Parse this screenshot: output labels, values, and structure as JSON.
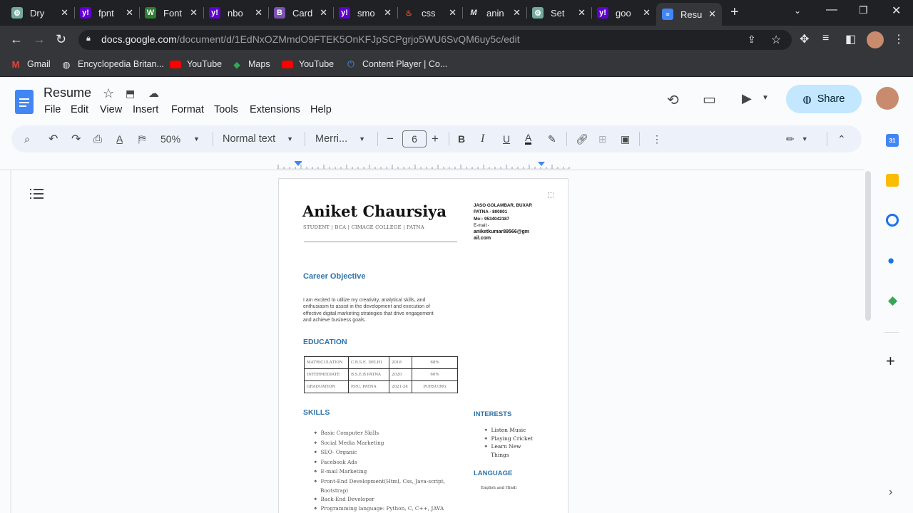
{
  "browser": {
    "tabs": [
      {
        "label": "Dry",
        "favicon": "chatgpt-icon",
        "color": "#74aa9c"
      },
      {
        "label": "fpnt",
        "favicon": "yahoo-icon",
        "color": "#6001d2"
      },
      {
        "label": "Font",
        "favicon": "w-icon",
        "color": "#1b5e20"
      },
      {
        "label": "nbo",
        "favicon": "yahoo-icon",
        "color": "#6001d2"
      },
      {
        "label": "Card",
        "favicon": "b-icon",
        "color": "#7952b3"
      },
      {
        "label": "smo",
        "favicon": "yahoo-icon",
        "color": "#6001d2"
      },
      {
        "label": "css",
        "favicon": "css-icon",
        "color": "#e44d26"
      },
      {
        "label": "anin",
        "favicon": "m-icon",
        "color": "#202124"
      },
      {
        "label": "Set",
        "favicon": "chatgpt-icon",
        "color": "#74aa9c"
      },
      {
        "label": "goo",
        "favicon": "yahoo-icon",
        "color": "#6001d2"
      },
      {
        "label": "Resu",
        "favicon": "docs-icon",
        "color": "#4285f4"
      }
    ],
    "url_host": "docs.google.com",
    "url_path": "/document/d/1EdNxOZMmdO9FTEK5OnKFJpSCPgrjo5WU6SvQM6uy5c/edit",
    "bookmarks": [
      {
        "label": "Gmail",
        "icon": "gmail-icon"
      },
      {
        "label": "Encyclopedia Britan...",
        "icon": "globe-icon"
      },
      {
        "label": "YouTube",
        "icon": "youtube-icon"
      },
      {
        "label": "Maps",
        "icon": "maps-icon"
      },
      {
        "label": "YouTube",
        "icon": "youtube-icon"
      },
      {
        "label": "Content Player | Co...",
        "icon": "power-icon"
      }
    ]
  },
  "docs": {
    "title": "Resume",
    "menu": [
      "File",
      "Edit",
      "View",
      "Insert",
      "Format",
      "Tools",
      "Extensions",
      "Help"
    ],
    "share_label": "Share",
    "toolbar": {
      "zoom": "50%",
      "style": "Normal text",
      "font": "Merri...",
      "font_size": "6",
      "minus": "−",
      "plus": "+"
    }
  },
  "resume": {
    "name": "Aniket Chaursiya",
    "subtitle": "STUDENT | BCA | CIMAGE COLLEGE | PATNA",
    "contact": [
      "JASO GOLAMBAR, BUXAR",
      "PATNA - 800001",
      "Mo:- 9534042187",
      "E-mail:-",
      "aniketkumar89566@gm",
      "ail.com"
    ],
    "career_objective_title": "Career Objective",
    "career_objective_lines": [
      "I am excited to utilize my creativity, analytical skills, and",
      "enthusiasm to assist in the development and execution of",
      "effective digital marketing strategies that drive engagement",
      "and achieve business goals."
    ],
    "education_title": "EDUCATION",
    "education": [
      [
        "MATRICULATION",
        "C.B.S.E. DELHI",
        "2018",
        "68%"
      ],
      [
        "INTERMEDIATE",
        "B.S.E.B PATNA",
        "2020",
        "60%"
      ],
      [
        "GRADUATION",
        "P.P.U. PATNA",
        "2021-24",
        "PURSUING"
      ]
    ],
    "skills_title": "SKILLS",
    "skills": [
      "Basic Computer Skills",
      "Social Media Marketing",
      "SEO- Organic",
      "Facebook Ads",
      "E-mail Marketing",
      "Front-End Development(Html, Css, Java-script, Bootstrap)",
      "Back-End Developer",
      "Programming language: Python, C, C++, JAVA"
    ],
    "interests_title": "INTERESTS",
    "interests": [
      "Listen Music",
      "Playing Cricket",
      "Learn New Things"
    ],
    "language_title": "LANGUAGE",
    "language": "English and Hindi"
  }
}
